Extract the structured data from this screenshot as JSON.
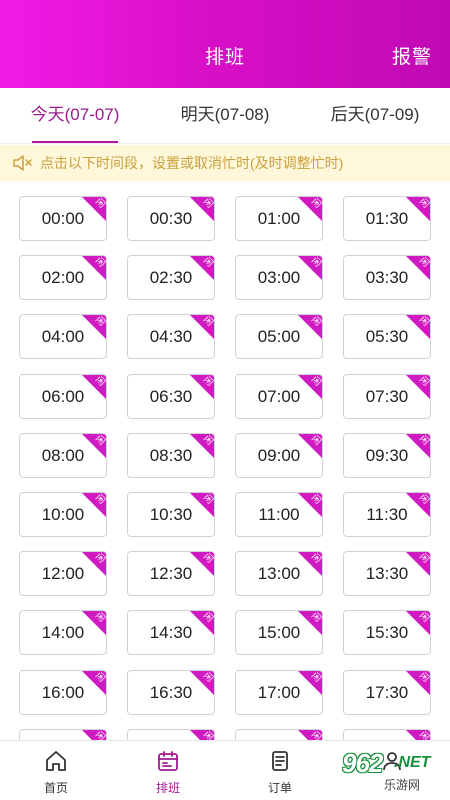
{
  "header": {
    "title": "排班",
    "report_label": "报警",
    "gradient_start": "#f21be6",
    "gradient_end": "#c00ab4"
  },
  "tabs": [
    {
      "label": "今天(07-07)",
      "active": true
    },
    {
      "label": "明天(07-08)",
      "active": false
    },
    {
      "label": "后天(07-09)",
      "active": false
    }
  ],
  "notice": {
    "icon": "speaker-icon",
    "text": "点击以下时间段，设置或取消忙时(及时调整忙时)"
  },
  "slots": [
    {
      "time": "00:00",
      "status": "闲"
    },
    {
      "time": "00:30",
      "status": "闲"
    },
    {
      "time": "01:00",
      "status": "闲"
    },
    {
      "time": "01:30",
      "status": "闲"
    },
    {
      "time": "02:00",
      "status": "闲"
    },
    {
      "time": "02:30",
      "status": "闲"
    },
    {
      "time": "03:00",
      "status": "闲"
    },
    {
      "time": "03:30",
      "status": "闲"
    },
    {
      "time": "04:00",
      "status": "闲"
    },
    {
      "time": "04:30",
      "status": "闲"
    },
    {
      "time": "05:00",
      "status": "闲"
    },
    {
      "time": "05:30",
      "status": "闲"
    },
    {
      "time": "06:00",
      "status": "闲"
    },
    {
      "time": "06:30",
      "status": "闲"
    },
    {
      "time": "07:00",
      "status": "闲"
    },
    {
      "time": "07:30",
      "status": "闲"
    },
    {
      "time": "08:00",
      "status": "闲"
    },
    {
      "time": "08:30",
      "status": "闲"
    },
    {
      "time": "09:00",
      "status": "闲"
    },
    {
      "time": "09:30",
      "status": "闲"
    },
    {
      "time": "10:00",
      "status": "闲"
    },
    {
      "time": "10:30",
      "status": "闲"
    },
    {
      "time": "11:00",
      "status": "闲"
    },
    {
      "time": "11:30",
      "status": "闲"
    },
    {
      "time": "12:00",
      "status": "闲"
    },
    {
      "time": "12:30",
      "status": "闲"
    },
    {
      "time": "13:00",
      "status": "闲"
    },
    {
      "time": "13:30",
      "status": "闲"
    },
    {
      "time": "14:00",
      "status": "闲"
    },
    {
      "time": "14:30",
      "status": "闲"
    },
    {
      "time": "15:00",
      "status": "闲"
    },
    {
      "time": "15:30",
      "status": "闲"
    },
    {
      "time": "16:00",
      "status": "闲"
    },
    {
      "time": "16:30",
      "status": "闲"
    },
    {
      "time": "17:00",
      "status": "闲"
    },
    {
      "time": "17:30",
      "status": "闲"
    },
    {
      "time": "",
      "status": "闲"
    },
    {
      "time": "",
      "status": "闲"
    },
    {
      "time": "",
      "status": "闲"
    },
    {
      "time": "",
      "status": "闲"
    }
  ],
  "bottom_nav": [
    {
      "label": "首页",
      "icon": "home-icon",
      "active": false
    },
    {
      "label": "排班",
      "icon": "calendar-icon",
      "active": true
    },
    {
      "label": "订单",
      "icon": "order-icon",
      "active": false
    },
    {
      "label": "",
      "icon": "user-icon",
      "active": false
    }
  ],
  "watermark": {
    "number": "962",
    "suffix": ".NET",
    "site": "乐游网"
  },
  "colors": {
    "accent": "#b1169f",
    "slot_corner": "#cf19c1",
    "notice_bg": "#fff7da",
    "notice_text": "#c9a13e"
  }
}
